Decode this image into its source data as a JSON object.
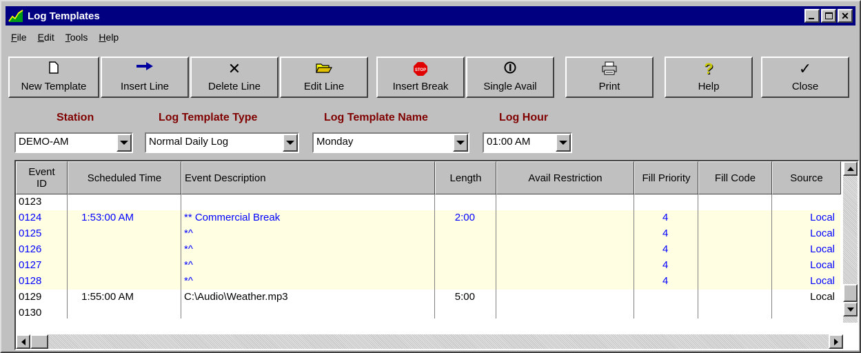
{
  "window": {
    "title": "Log Templates"
  },
  "menu": [
    {
      "accel": "F",
      "rest": "ile"
    },
    {
      "accel": "E",
      "rest": "dit"
    },
    {
      "accel": "T",
      "rest": "ools"
    },
    {
      "accel": "H",
      "rest": "elp"
    }
  ],
  "toolbar": {
    "new_template": "New Template",
    "insert_line": "Insert Line",
    "delete_line": "Delete Line",
    "edit_line": "Edit Line",
    "insert_break": "Insert Break",
    "single_avail": "Single Avail",
    "print": "Print",
    "help": "Help",
    "close": "Close",
    "stop_sign_text": "STOP"
  },
  "filters": {
    "station_label": "Station",
    "station_value": "DEMO-AM",
    "type_label": "Log Template Type",
    "type_value": "Normal Daily Log",
    "name_label": "Log Template Name",
    "name_value": "Monday",
    "hour_label": "Log Hour",
    "hour_value": "01:00 AM"
  },
  "grid": {
    "headers": {
      "event_id": "Event ID",
      "scheduled_time": "Scheduled Time",
      "description": "Event Description",
      "length": "Length",
      "avail_restriction": "Avail Restriction",
      "fill_priority": "Fill Priority",
      "fill_code": "Fill Code",
      "source": "Source"
    },
    "rows": [
      {
        "id": "0123",
        "time": "",
        "desc": "",
        "length": "",
        "avail": "",
        "priority": "",
        "fill_code": "",
        "source": ""
      },
      {
        "id": "0124",
        "time": "1:53:00 AM",
        "desc": "** Commercial Break",
        "length": "2:00",
        "avail": "",
        "priority": "4",
        "fill_code": "",
        "source": "Local"
      },
      {
        "id": "0125",
        "time": "",
        "desc": "*^",
        "length": "",
        "avail": "",
        "priority": "4",
        "fill_code": "",
        "source": "Local"
      },
      {
        "id": "0126",
        "time": "",
        "desc": "*^",
        "length": "",
        "avail": "",
        "priority": "4",
        "fill_code": "",
        "source": "Local"
      },
      {
        "id": "0127",
        "time": "",
        "desc": "*^",
        "length": "",
        "avail": "",
        "priority": "4",
        "fill_code": "",
        "source": "Local"
      },
      {
        "id": "0128",
        "time": "",
        "desc": "*^",
        "length": "",
        "avail": "",
        "priority": "4",
        "fill_code": "",
        "source": "Local"
      },
      {
        "id": "0129",
        "time": "1:55:00 AM",
        "desc": "C:\\Audio\\Weather.mp3",
        "length": "5:00",
        "avail": "",
        "priority": "",
        "fill_code": "",
        "source": "Local"
      },
      {
        "id": "0130",
        "time": "",
        "desc": "",
        "length": "",
        "avail": "",
        "priority": "",
        "fill_code": "",
        "source": ""
      }
    ],
    "highlight_color": "#fffee2",
    "highlight_text_color": "#0000ff"
  },
  "colors": {
    "titlebar": "#000080",
    "label": "#800000",
    "face": "#c0c0c0"
  }
}
